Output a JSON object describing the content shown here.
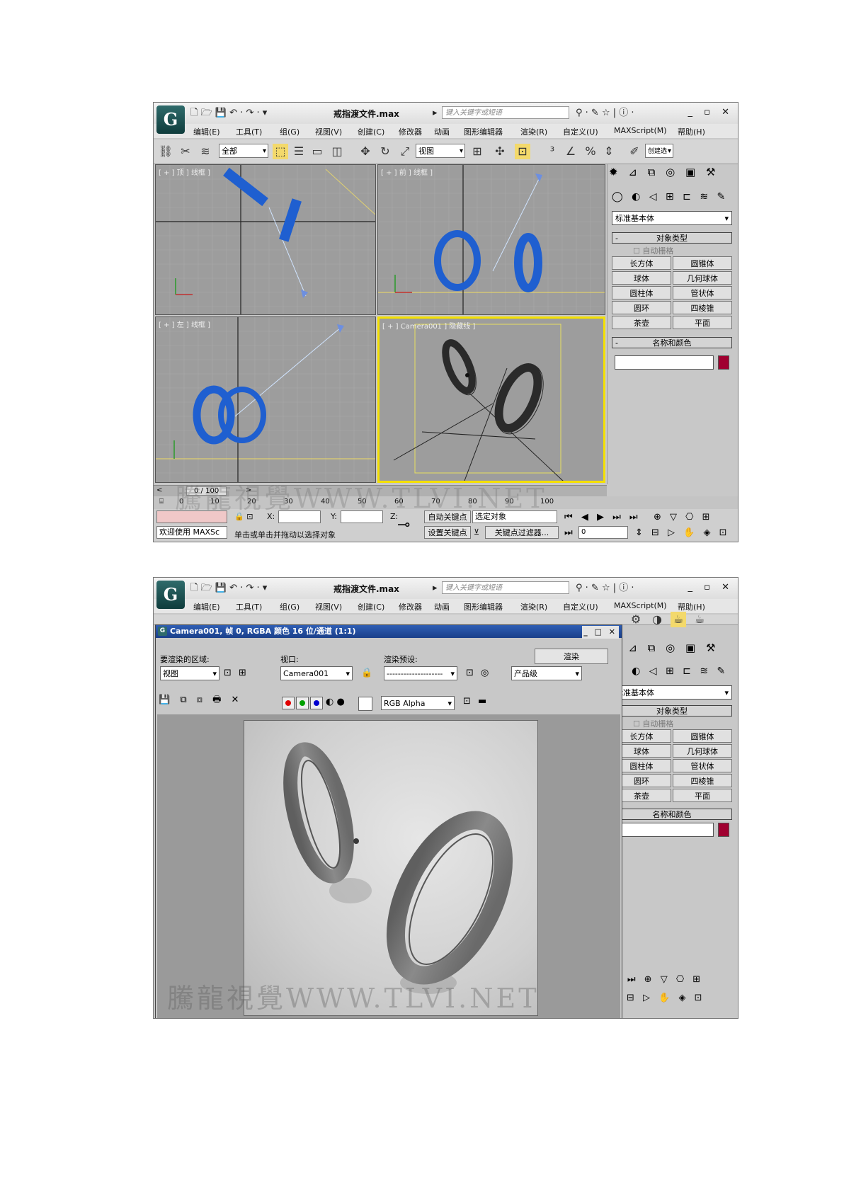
{
  "app": {
    "logo": "G",
    "document_title": "戒指渡文件.max",
    "search_placeholder": "键入关键字或短语",
    "window_controls": "_ ▫ ✕"
  },
  "menu": [
    "编辑(E)",
    "工具(T)",
    "组(G)",
    "视图(V)",
    "创建(C)",
    "修改器",
    "动画",
    "图形编辑器",
    "渲染(R)",
    "自定义(U)",
    "MAXScript(M)",
    "帮助(H)"
  ],
  "toolbar": {
    "selection_filter": "全部",
    "reference_coord": "视图",
    "named_sel": "创建选"
  },
  "viewports": [
    {
      "label": "[ + ] 顶 ] 线框 ]"
    },
    {
      "label": "[ + ] 前 ] 线框 ]"
    },
    {
      "label": "[ + ] 左 ] 线框 ]"
    },
    {
      "label": "[ + ] Camera001 ] 隐藏线 ]"
    }
  ],
  "command_panel": {
    "category": "标准基本体",
    "object_type_title": "对象类型",
    "autogrid": "自动栅格",
    "primitives": [
      "长方体",
      "圆锥体",
      "球体",
      "几何球体",
      "圆柱体",
      "管状体",
      "圆环",
      "四棱锥",
      "茶壶",
      "平面"
    ],
    "name_color_title": "名称和颜色",
    "swatch_color": "#a00030",
    "rollout_minus": "-"
  },
  "timeline": {
    "frame": "0 / 100",
    "ticks": [
      "0",
      "10",
      "20",
      "30",
      "40",
      "50",
      "60",
      "70",
      "80",
      "90",
      "100"
    ],
    "nav_left": "<",
    "nav_right": ">"
  },
  "status": {
    "welcome": "欢迎使用 MAXSc",
    "prompt": "单击或单击并拖动以选择对象",
    "x_label": "X:",
    "y_label": "Y:",
    "z_label": "Z:",
    "auto_key": "自动关键点",
    "set_key": "设置关键点",
    "key_filter": "关键点过滤器...",
    "selected_object": "选定对象",
    "frame_field": "0"
  },
  "render_window": {
    "title": "Camera001, 帧 0, RGBA 颜色 16 位/通道 (1:1)",
    "area_label": "要渲染的区域:",
    "area_value": "视图",
    "viewport_label": "视口:",
    "viewport_value": "Camera001",
    "preset_label": "渲染预设:",
    "preset_value": "--------------------",
    "render_button": "渲染",
    "quality_value": "产品级",
    "channel_value": "RGB Alpha",
    "window_controls": "_ □ ✕"
  },
  "watermark": "騰龍視覺WWW.TLVI.NET"
}
